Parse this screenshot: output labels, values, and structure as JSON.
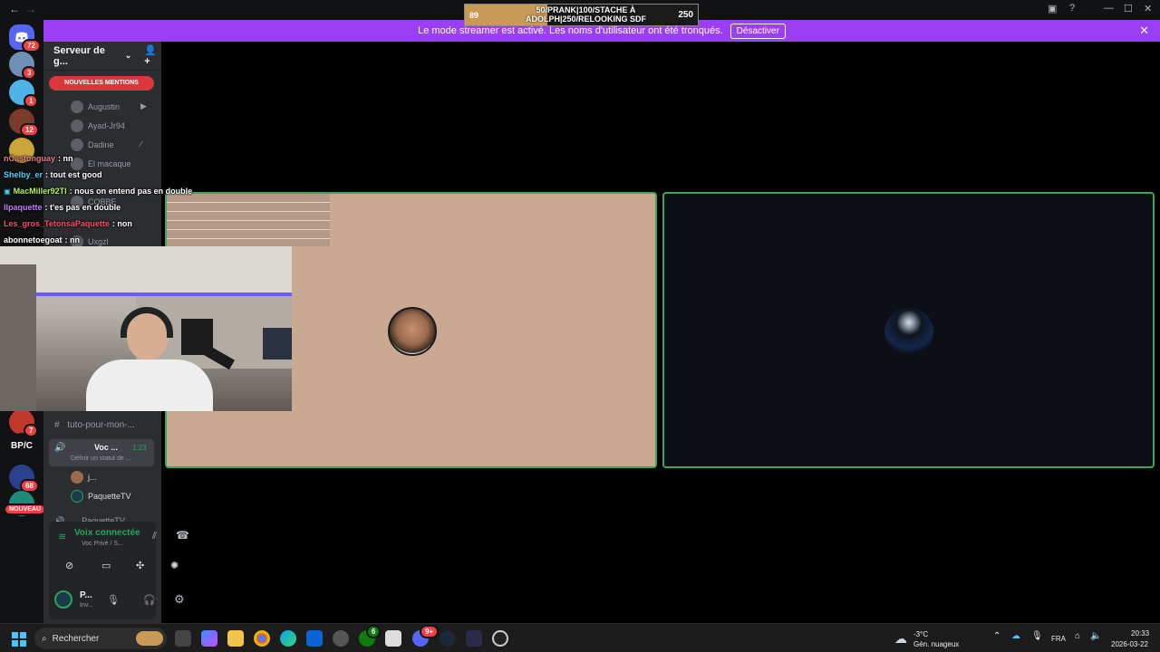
{
  "score": {
    "left": "89",
    "right": "250",
    "line1": "50/PRANK|100/STACHE À",
    "line2": "ADOLPH|250/RELOOKING SDF",
    "progress": 0.356
  },
  "banner": {
    "text": "Le mode streamer est activé. Les noms d'utilisateur ont été tronqués.",
    "button": "Désactiver",
    "close": "✕"
  },
  "servers": [
    {
      "badge": "72",
      "color": "#5865f2",
      "glyph": "🎮"
    },
    {
      "badge": "3",
      "color": "#6f8fb5",
      "glyph": ""
    },
    {
      "badge": "1",
      "color": "#4fb3e8",
      "glyph": ""
    },
    {
      "badge": "12",
      "color": "#7a3b2a",
      "glyph": ""
    },
    {
      "badge": "",
      "color": "#caa63a",
      "glyph": ""
    },
    {
      "badge": "7",
      "color": "#c0392b",
      "glyph": ""
    },
    {
      "badge": "",
      "color": "#111214",
      "glyph": "BP/C"
    },
    {
      "badge": "68",
      "color": "#2b3f8a",
      "glyph": ""
    },
    {
      "badge": "NOUVEAU",
      "color": "#1d8a7a",
      "glyph": ""
    }
  ],
  "sidebar": {
    "server_name": "Serveur de g...",
    "new_mentions": "NOUVELLES MENTIONS",
    "voice_users": [
      "Augustin",
      "Ayad-Jr94",
      "Dadine",
      "El macaque",
      "COBBE",
      "Uxgzl"
    ],
    "text_channel": "tuto-pour-mon-...",
    "voice_channel": "Voc ...",
    "voice_time": "1:23",
    "voice_status": "Définir un statut de ...",
    "voice_members": [
      "j...",
      "PaquetteTV"
    ],
    "next_channel": "PaquetteTV",
    "connection_title": "Voix connectée",
    "connection_sub": "Voc Privé / S...",
    "user_name": "P...",
    "user_status": "Inv..."
  },
  "chat": [
    {
      "user": "nCastonguay",
      "text": ": nn",
      "color": "#e08080"
    },
    {
      "user": "Shelby_er",
      "text": ": tout est good",
      "color": "#4fd1ff"
    },
    {
      "user": "MacMiller92Tl",
      "text": ": nous on entend pas en double",
      "color": "#b8f05a"
    },
    {
      "user": "llpaquette",
      "text": ": t'es pas en double",
      "color": "#c77dff"
    },
    {
      "user": "Les_gros_TetonsaPaquette",
      "text": ": non",
      "color": "#ff4d6d"
    },
    {
      "user": "abonnetoegoat",
      "text": ": nn",
      "color": "#ffffff"
    }
  ],
  "taskbar": {
    "search": "Rechercher",
    "weather_temp": "-3°C",
    "weather_desc": "Gén. nuageux",
    "lang": "FRA",
    "time": "20:33",
    "date": "2026-03-22",
    "discord_badge": "9+",
    "xbox_badge": "6"
  }
}
